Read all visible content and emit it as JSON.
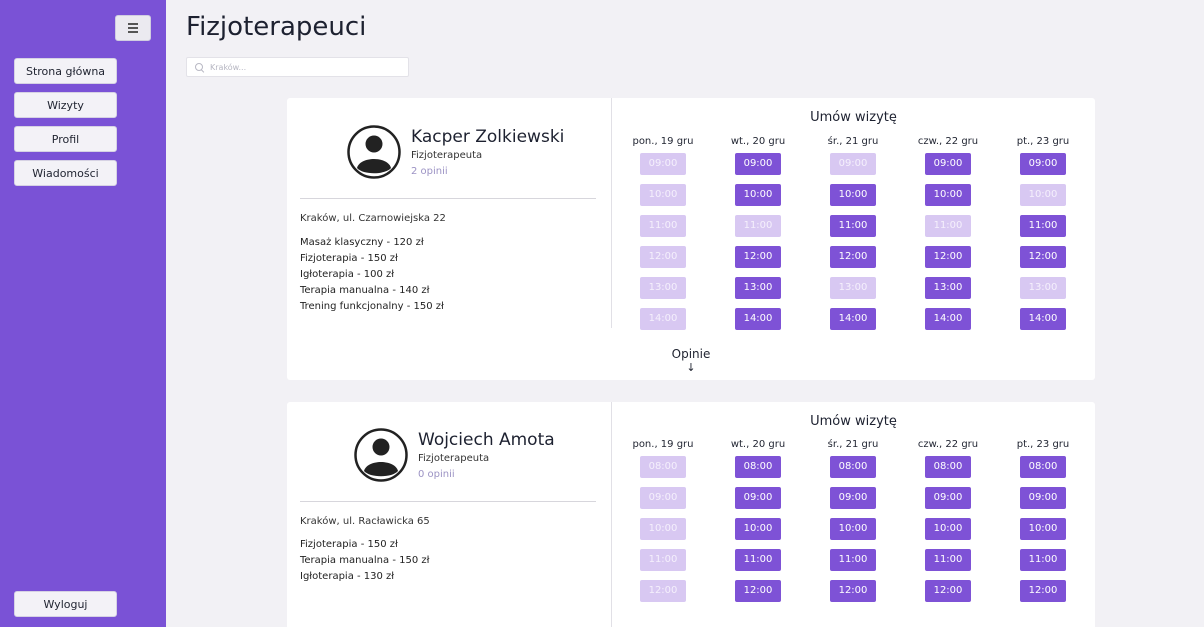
{
  "sidebar": {
    "items": [
      {
        "label": "Strona główna"
      },
      {
        "label": "Wizyty"
      },
      {
        "label": "Profil"
      },
      {
        "label": "Wiadomości"
      }
    ],
    "logout_label": "Wyloguj"
  },
  "header": {
    "title": "Fizjoterapeuci"
  },
  "search": {
    "placeholder": "Kraków..."
  },
  "colors": {
    "sidebar_bg": "#7a52d6",
    "slot_available": "#7e52d6",
    "slot_unavailable": "#d8c8f2",
    "reviews_link": "#9c93c4"
  },
  "therapists": [
    {
      "name": "Kacper Zolkiewski",
      "role": "Fizjoterapeuta",
      "reviews": "2 opinii",
      "address": "Kraków, ul. Czarnowiejska 22",
      "services": [
        "Masaż klasyczny - 120 zł",
        "Fizjoterapia - 150 zł",
        "Igłoterapia - 100 zł",
        "Terapia manualna - 140 zł",
        "Trening funkcjonalny - 150 zł"
      ],
      "booking_title": "Umów wizytę",
      "reviews_toggle": "Opinie",
      "days": [
        {
          "label": "pon., 19 gru",
          "slots": [
            {
              "time": "09:00",
              "available": false
            },
            {
              "time": "10:00",
              "available": false
            },
            {
              "time": "11:00",
              "available": false
            },
            {
              "time": "12:00",
              "available": false
            },
            {
              "time": "13:00",
              "available": false
            },
            {
              "time": "14:00",
              "available": false
            }
          ]
        },
        {
          "label": "wt., 20 gru",
          "slots": [
            {
              "time": "09:00",
              "available": true
            },
            {
              "time": "10:00",
              "available": true
            },
            {
              "time": "11:00",
              "available": false
            },
            {
              "time": "12:00",
              "available": true
            },
            {
              "time": "13:00",
              "available": true
            },
            {
              "time": "14:00",
              "available": true
            }
          ]
        },
        {
          "label": "śr., 21 gru",
          "slots": [
            {
              "time": "09:00",
              "available": false
            },
            {
              "time": "10:00",
              "available": true
            },
            {
              "time": "11:00",
              "available": true
            },
            {
              "time": "12:00",
              "available": true
            },
            {
              "time": "13:00",
              "available": false
            },
            {
              "time": "14:00",
              "available": true
            }
          ]
        },
        {
          "label": "czw., 22 gru",
          "slots": [
            {
              "time": "09:00",
              "available": true
            },
            {
              "time": "10:00",
              "available": true
            },
            {
              "time": "11:00",
              "available": false
            },
            {
              "time": "12:00",
              "available": true
            },
            {
              "time": "13:00",
              "available": true
            },
            {
              "time": "14:00",
              "available": true
            }
          ]
        },
        {
          "label": "pt., 23 gru",
          "slots": [
            {
              "time": "09:00",
              "available": true
            },
            {
              "time": "10:00",
              "available": false
            },
            {
              "time": "11:00",
              "available": true
            },
            {
              "time": "12:00",
              "available": true
            },
            {
              "time": "13:00",
              "available": false
            },
            {
              "time": "14:00",
              "available": true
            }
          ]
        }
      ]
    },
    {
      "name": "Wojciech Amota",
      "role": "Fizjoterapeuta",
      "reviews": "0 opinii",
      "address": "Kraków, ul. Racławicka 65",
      "services": [
        "Fizjoterapia - 150 zł",
        "Terapia manualna - 150 zł",
        "Igłoterapia - 130 zł"
      ],
      "booking_title": "Umów wizytę",
      "days": [
        {
          "label": "pon., 19 gru",
          "slots": [
            {
              "time": "08:00",
              "available": false
            },
            {
              "time": "09:00",
              "available": false
            },
            {
              "time": "10:00",
              "available": false
            },
            {
              "time": "11:00",
              "available": false
            },
            {
              "time": "12:00",
              "available": false
            }
          ]
        },
        {
          "label": "wt., 20 gru",
          "slots": [
            {
              "time": "08:00",
              "available": true
            },
            {
              "time": "09:00",
              "available": true
            },
            {
              "time": "10:00",
              "available": true
            },
            {
              "time": "11:00",
              "available": true
            },
            {
              "time": "12:00",
              "available": true
            }
          ]
        },
        {
          "label": "śr., 21 gru",
          "slots": [
            {
              "time": "08:00",
              "available": true
            },
            {
              "time": "09:00",
              "available": true
            },
            {
              "time": "10:00",
              "available": true
            },
            {
              "time": "11:00",
              "available": true
            },
            {
              "time": "12:00",
              "available": true
            }
          ]
        },
        {
          "label": "czw., 22 gru",
          "slots": [
            {
              "time": "08:00",
              "available": true
            },
            {
              "time": "09:00",
              "available": true
            },
            {
              "time": "10:00",
              "available": true
            },
            {
              "time": "11:00",
              "available": true
            },
            {
              "time": "12:00",
              "available": true
            }
          ]
        },
        {
          "label": "pt., 23 gru",
          "slots": [
            {
              "time": "08:00",
              "available": true
            },
            {
              "time": "09:00",
              "available": true
            },
            {
              "time": "10:00",
              "available": true
            },
            {
              "time": "11:00",
              "available": true
            },
            {
              "time": "12:00",
              "available": true
            }
          ]
        }
      ]
    }
  ]
}
